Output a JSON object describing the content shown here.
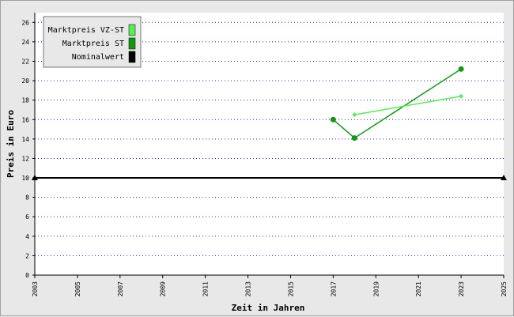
{
  "chart_data": {
    "type": "line",
    "xlabel": "Zeit in Jahren",
    "ylabel": "Preis in Euro",
    "xlim": [
      2003,
      2025
    ],
    "ylim": [
      0,
      27
    ],
    "xticks": [
      2003,
      2005,
      2007,
      2009,
      2011,
      2013,
      2015,
      2017,
      2019,
      2021,
      2023,
      2025
    ],
    "yticks": [
      0,
      2,
      4,
      6,
      8,
      10,
      12,
      14,
      16,
      18,
      20,
      22,
      24,
      26
    ],
    "grid": "horizontal dotted",
    "legend_position": "top-left",
    "series": [
      {
        "name": "Marktpreis VZ-ST",
        "color": "#55ee55",
        "marker": "diamond",
        "points": [
          [
            2018,
            16.5
          ],
          [
            2023,
            18.4
          ]
        ]
      },
      {
        "name": "Marktpreis ST",
        "color": "#119911",
        "marker": "circle",
        "points": [
          [
            2017,
            16.0
          ],
          [
            2018,
            14.1
          ],
          [
            2023,
            21.2
          ]
        ]
      },
      {
        "name": "Nominalwert",
        "color": "#000000",
        "marker": "triangle",
        "points": [
          [
            2003,
            10
          ],
          [
            2025,
            10
          ]
        ]
      }
    ]
  }
}
